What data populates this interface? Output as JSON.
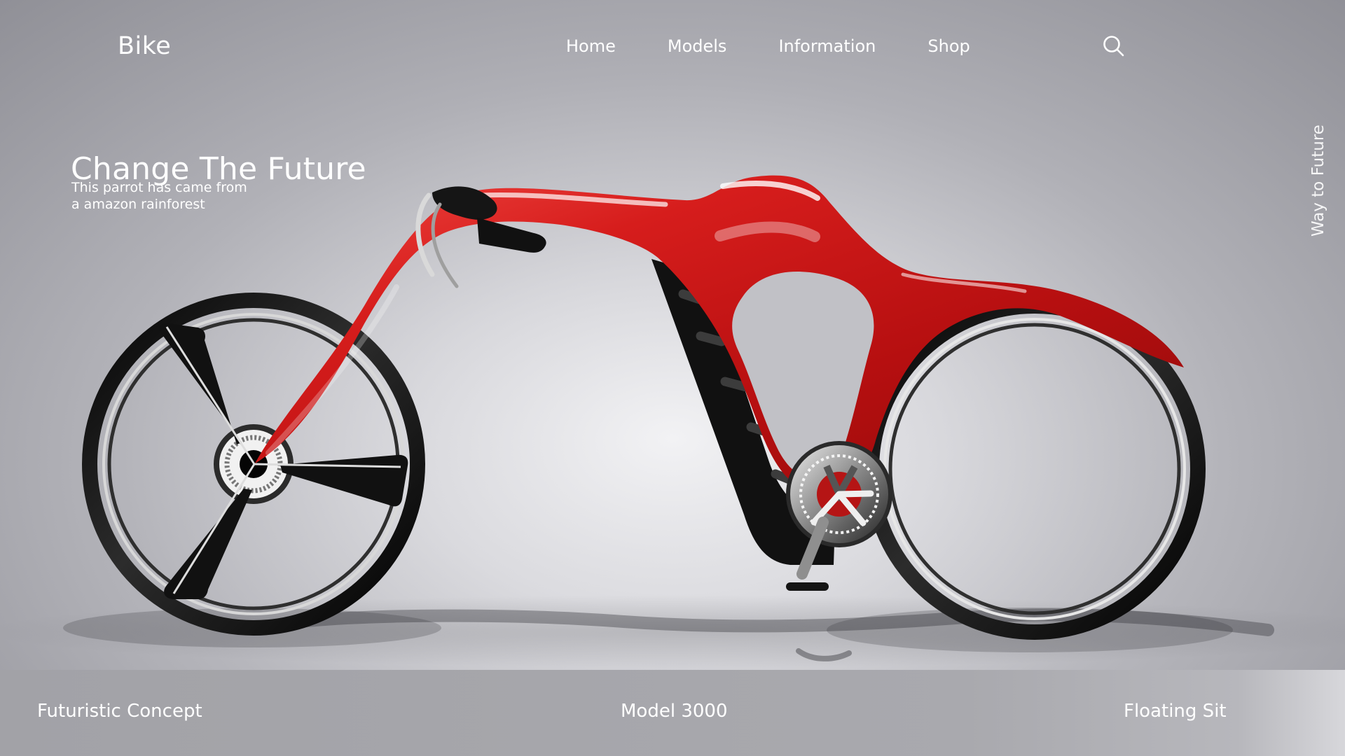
{
  "header": {
    "brand": "Bike",
    "nav": [
      "Home",
      "Models",
      "Information",
      "Shop"
    ],
    "search_icon": "search-icon"
  },
  "hero": {
    "headline": "Change The Future",
    "subcopy": [
      "This parrot has came from",
      "a amazon rainforest"
    ],
    "vertical_text": "Way to Future"
  },
  "features": {
    "left": "Futuristic Concept",
    "center": "Model 3000",
    "right": "Floating Sit"
  },
  "colors": {
    "accent": "#d11616",
    "text": "#ffffff",
    "bar": "#a8a8ad"
  }
}
